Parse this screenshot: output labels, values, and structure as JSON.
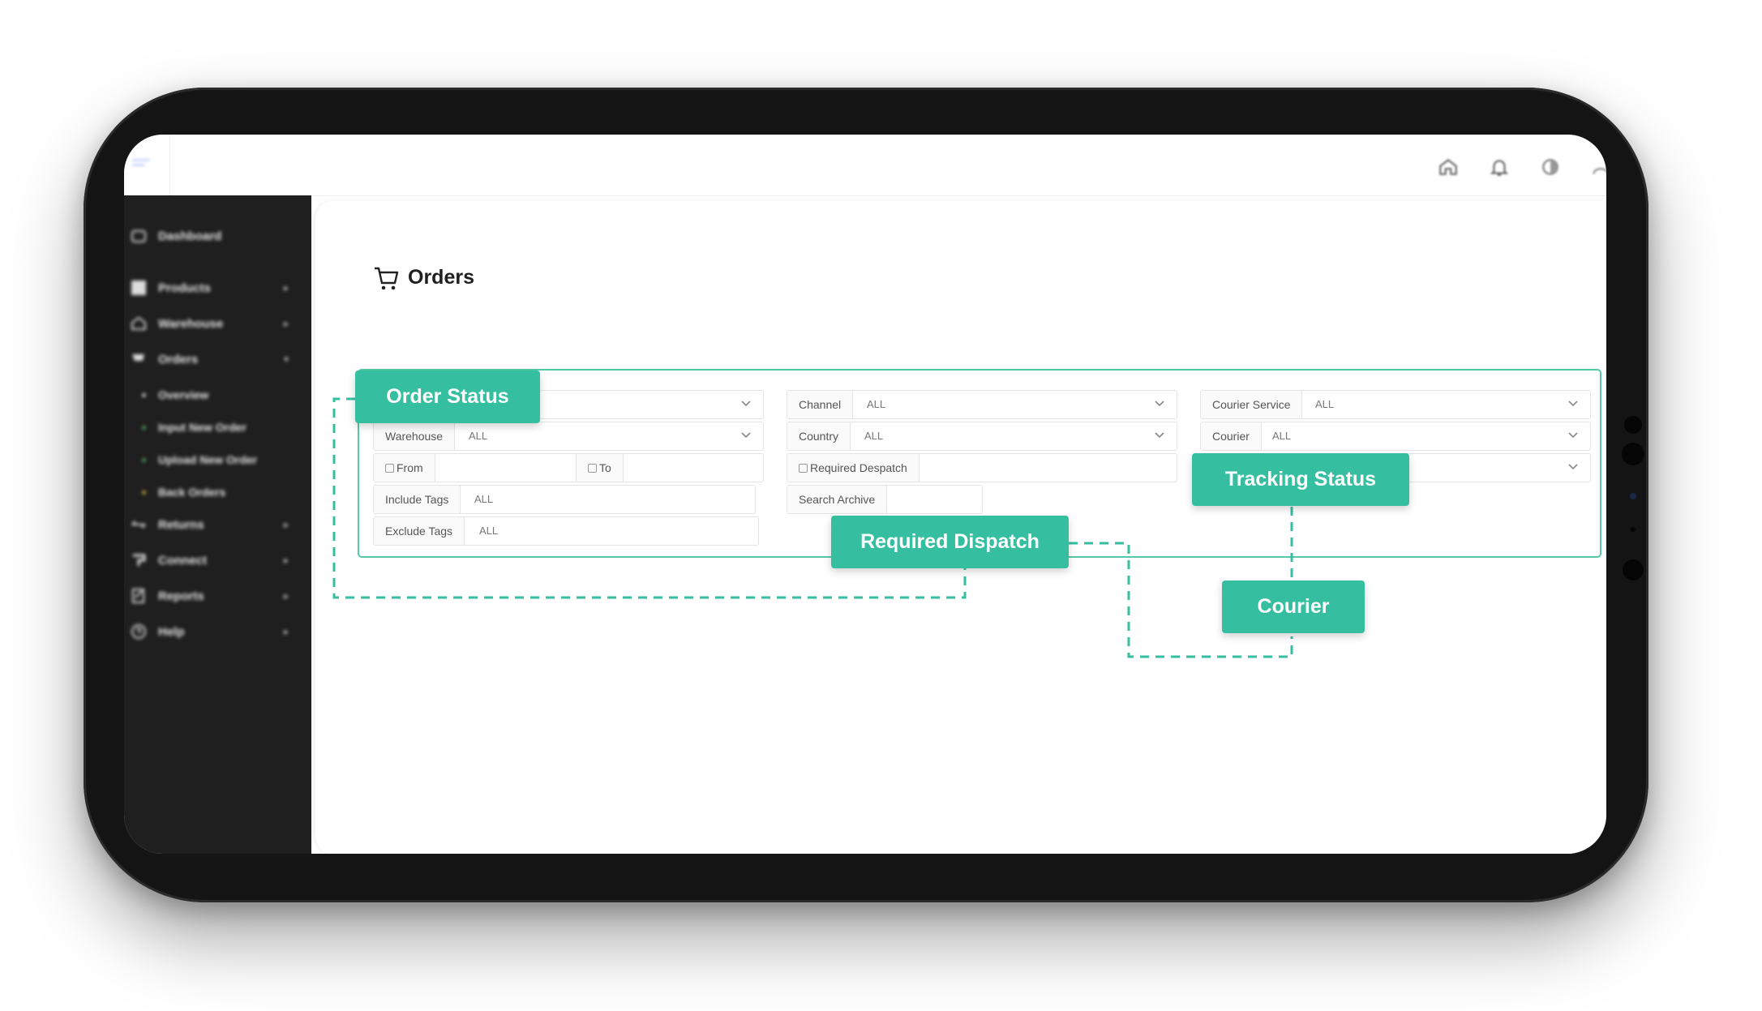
{
  "page": {
    "title": "Orders"
  },
  "sidebar": {
    "items": [
      {
        "label": "Dashboard"
      },
      {
        "label": "Products"
      },
      {
        "label": "Warehouse"
      },
      {
        "label": "Orders"
      },
      {
        "label": "Overview"
      },
      {
        "label": "Input New Order"
      },
      {
        "label": "Upload New Order"
      },
      {
        "label": "Back Orders"
      },
      {
        "label": "Returns"
      },
      {
        "label": "Connect"
      },
      {
        "label": "Reports"
      },
      {
        "label": "Help"
      }
    ]
  },
  "filters": {
    "warehouse": {
      "label": "Warehouse",
      "value": "ALL"
    },
    "from": {
      "label": "From",
      "value": ""
    },
    "to": {
      "label": "To",
      "value": ""
    },
    "include_tags": {
      "label": "Include Tags",
      "value": "ALL"
    },
    "exclude_tags": {
      "label": "Exclude Tags",
      "value": "ALL"
    },
    "channel": {
      "label": "Channel",
      "value": "ALL"
    },
    "country": {
      "label": "Country",
      "value": "ALL"
    },
    "required_despatch": {
      "label": "Required Despatch",
      "value": ""
    },
    "search_archive": {
      "label": "Search Archive",
      "value": ""
    },
    "courier_service": {
      "label": "Courier Service",
      "value": "ALL"
    },
    "courier": {
      "label": "Courier",
      "value": "ALL"
    }
  },
  "callouts": {
    "order_status": "Order Status",
    "required_dispatch": "Required Dispatch",
    "tracking_status": "Tracking Status",
    "courier": "Courier"
  },
  "colors": {
    "accent": "#35bea0",
    "sidebar": "#1f1f1f",
    "device": "#141414"
  },
  "icons": [
    "home-icon",
    "bell-icon",
    "theme-toggle-icon",
    "cart-icon",
    "chevron-down-icon",
    "calendar-icon"
  ]
}
